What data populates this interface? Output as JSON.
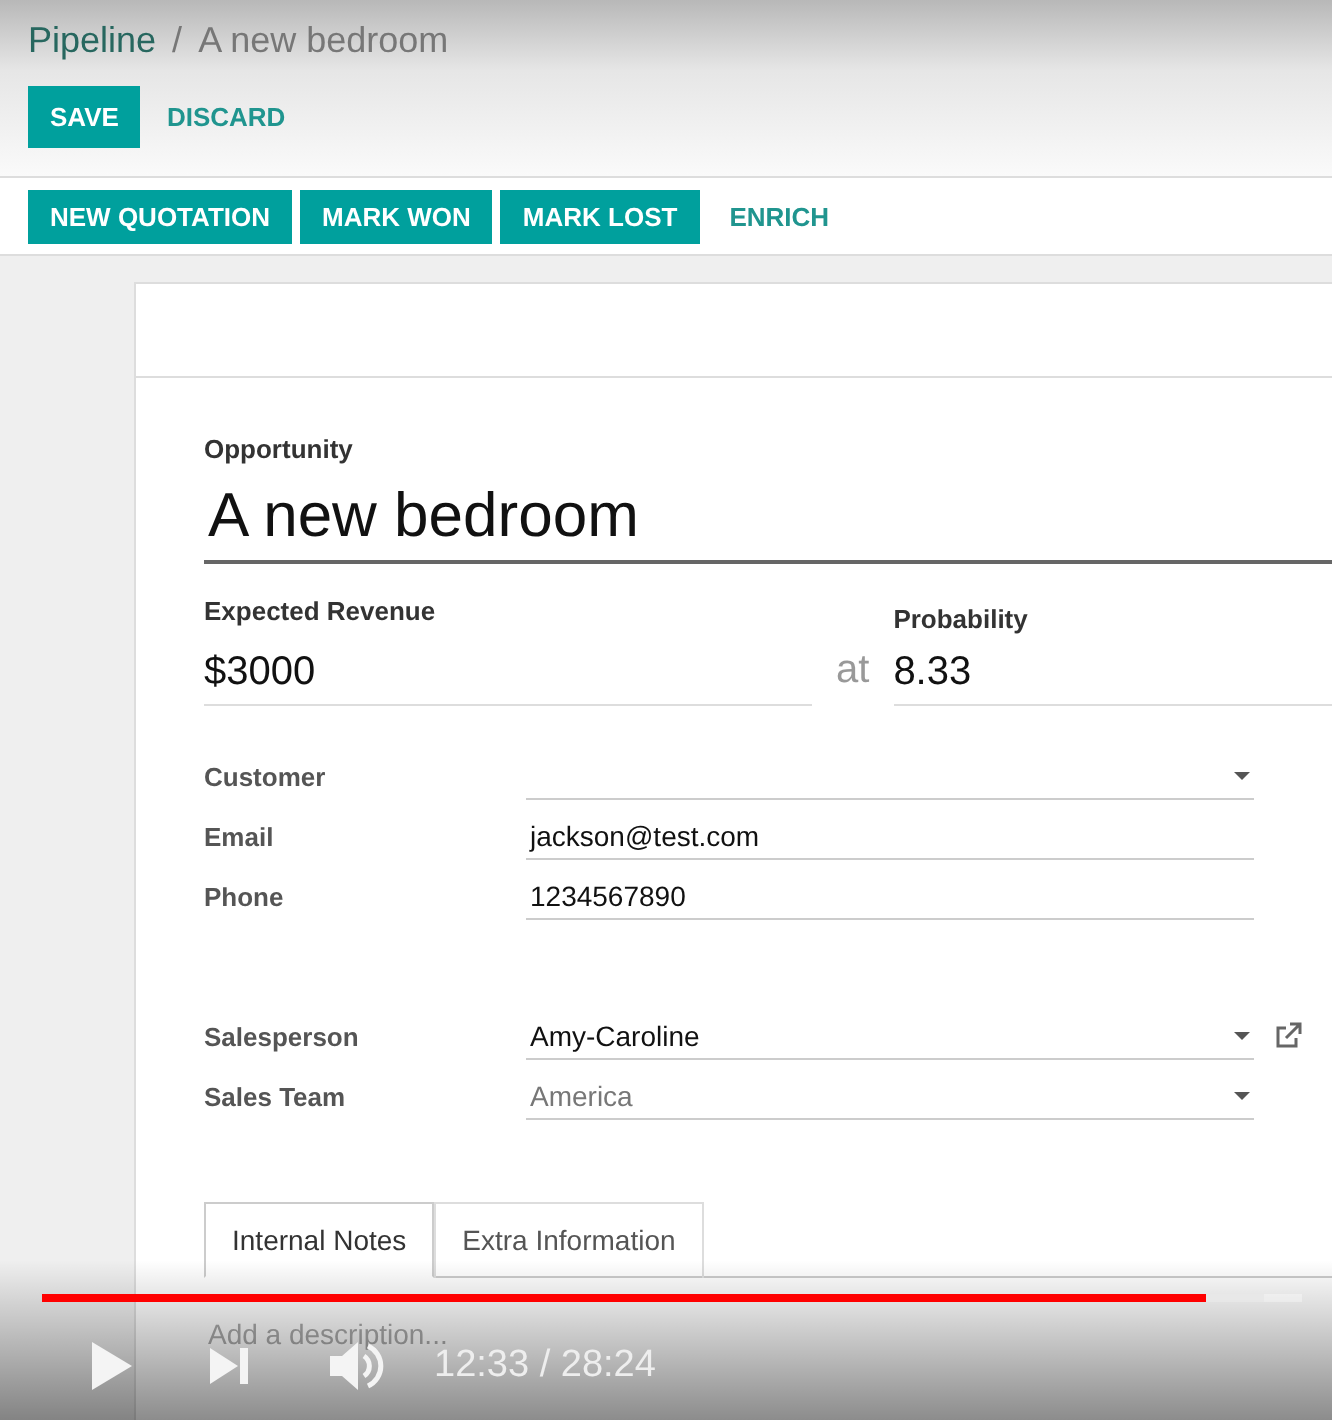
{
  "breadcrumb": {
    "parent": "Pipeline",
    "separator": "/",
    "current": "A new bedroom"
  },
  "edit_buttons": [
    {
      "label": "SAVE",
      "kind": "primary"
    },
    {
      "label": "DISCARD",
      "kind": "link"
    }
  ],
  "action_buttons": [
    {
      "label": "NEW QUOTATION",
      "kind": "primary"
    },
    {
      "label": "MARK WON",
      "kind": "primary"
    },
    {
      "label": "MARK LOST",
      "kind": "primary"
    },
    {
      "label": "ENRICH",
      "kind": "link"
    }
  ],
  "form": {
    "opportunity_label": "Opportunity",
    "opportunity": "A new bedroom",
    "revenue_label": "Expected Revenue",
    "revenue": "$3000",
    "at": "at",
    "probability_label": "Probability",
    "probability": "8.33",
    "fields": [
      {
        "label": "Customer",
        "kind": "dropdown",
        "external_link": false
      },
      {
        "label": "Email",
        "value": "jackson@test.com",
        "kind": "text",
        "muted": false,
        "external_link": false
      },
      {
        "label": "Phone",
        "value": "1234567890",
        "kind": "text",
        "muted": false,
        "external_link": false
      },
      {
        "label": "Salesperson",
        "value": "Amy-Caroline",
        "kind": "dropdown",
        "muted": false,
        "external_link": true
      },
      {
        "label": "Sales Team",
        "value": "America",
        "kind": "dropdown",
        "muted": true,
        "external_link": false
      }
    ],
    "tabs": [
      {
        "label": "Internal Notes",
        "selected": true
      },
      {
        "label": "Extra Information",
        "selected": false
      }
    ],
    "description": {
      "placeholder": "Add a description..."
    }
  },
  "player": {
    "level": 0.924,
    "time": "12:33 / 28:24"
  }
}
